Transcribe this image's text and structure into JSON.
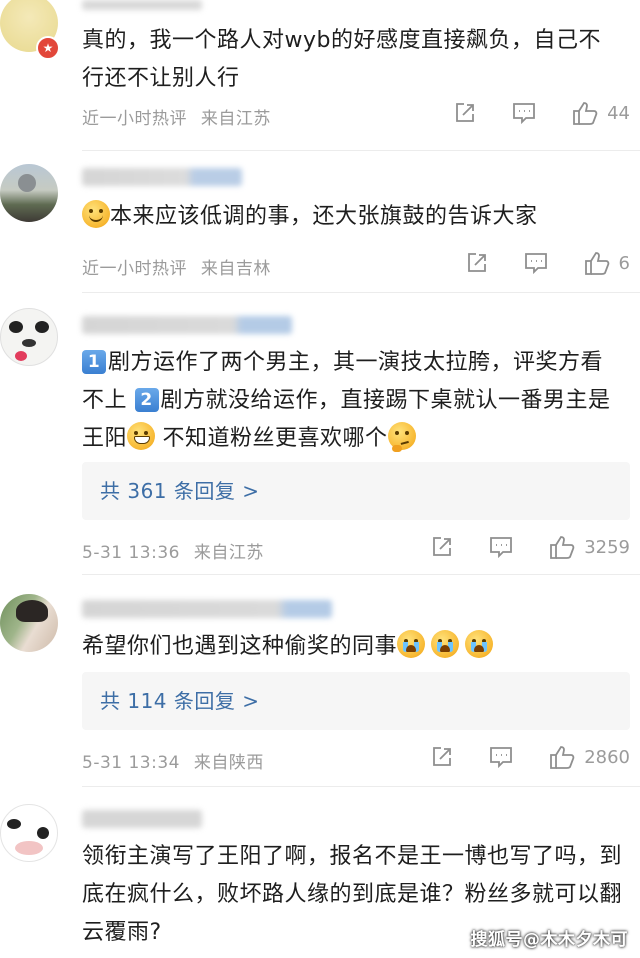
{
  "comments": [
    {
      "text": "真的，我一个路人对wyb的好感度直接飙负，自己不行还不让别人行",
      "time": "近一小时热评",
      "location": "来自江苏",
      "likes": "44",
      "avatar": "blurred-pale-avatar",
      "has_badge": true
    },
    {
      "emoji_lead": "cry-laugh-emoji",
      "text": "本来应该低调的事，还大张旗鼓的告诉大家",
      "time": "近一小时热评",
      "location": "来自吉林",
      "likes": "6",
      "avatar": "outdoor-scene-avatar"
    },
    {
      "num1": "1",
      "part1": "剧方运作了两个男主，其一演技太拉胯，评奖方看不上",
      "num2": "2",
      "part2": "剧方就没给运作，直接踢下桌就认一番男主是王阳",
      "emoji_mid": "grin-emoji",
      "part3": " 不知道粉丝更喜欢哪个",
      "emoji_end": "thinking-emoji",
      "replies": "共 361 条回复 >",
      "time": "5-31 13:36",
      "location": "来自江苏",
      "likes": "3259",
      "avatar": "panda-avatar"
    },
    {
      "text": "希望你们也遇到这种偷奖的同事",
      "emoji_end": "crying-emoji",
      "replies": "共 114 条回复 >",
      "time": "5-31 13:34",
      "location": "来自陕西",
      "likes": "2860",
      "avatar": "person-photo-avatar"
    },
    {
      "text": "领衔主演写了王阳了啊，报名不是王一博也写了吗，到底在疯什么，败坏路人缘的到底是谁？粉丝多就可以翻云覆雨?",
      "avatar": "cow-avatar"
    }
  ],
  "watermark": "搜狐号@木木夕木可",
  "colors": {
    "link": "#3d6ea6",
    "meta": "#9b9b9b",
    "text": "#1e1e1e",
    "reply_bg": "#f6f6f6"
  }
}
